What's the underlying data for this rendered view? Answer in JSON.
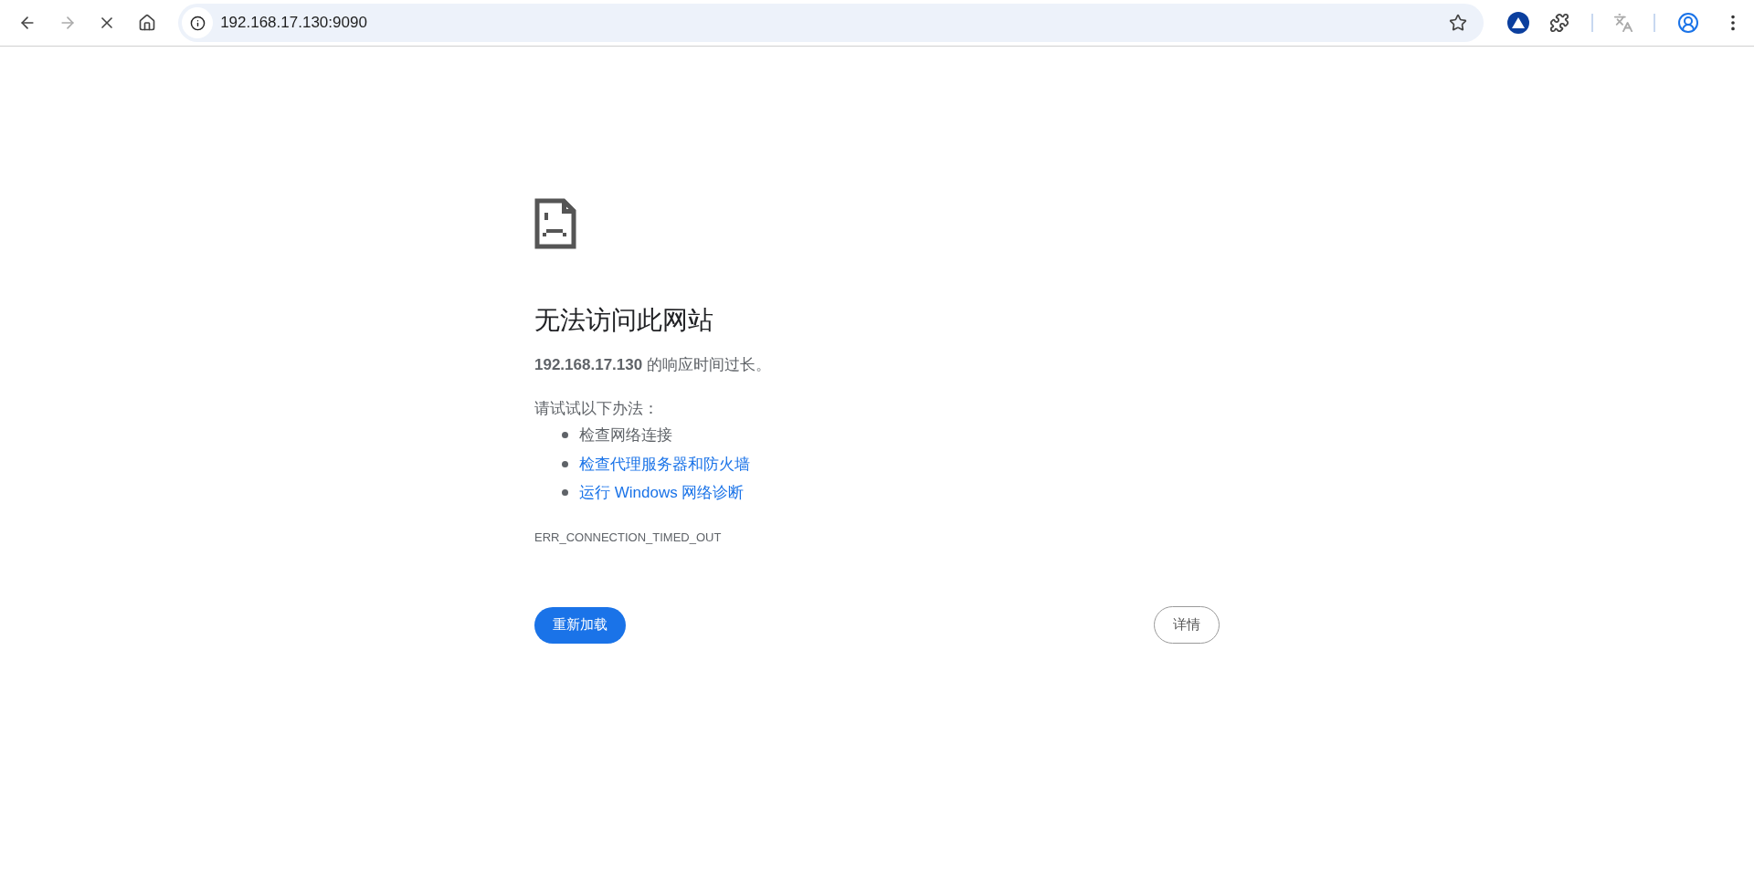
{
  "toolbar": {
    "forward_disabled": true,
    "address": "192.168.17.130:9090"
  },
  "error": {
    "title": "无法访问此网站",
    "description": "**192.168.17.130** 的响应时间过长。",
    "suggestions_intro": "请试试以下办法：",
    "suggestions": [
      {
        "kind": "text",
        "label": "检查网络连接"
      },
      {
        "kind": "link",
        "label": "检查代理服务器和防火墙"
      },
      {
        "kind": "link",
        "label": "运行 Windows 网络诊断"
      }
    ],
    "code": "ERR_CONNECTION_TIMED_OUT",
    "reload_button": "重新加载",
    "details_button": "详情"
  }
}
